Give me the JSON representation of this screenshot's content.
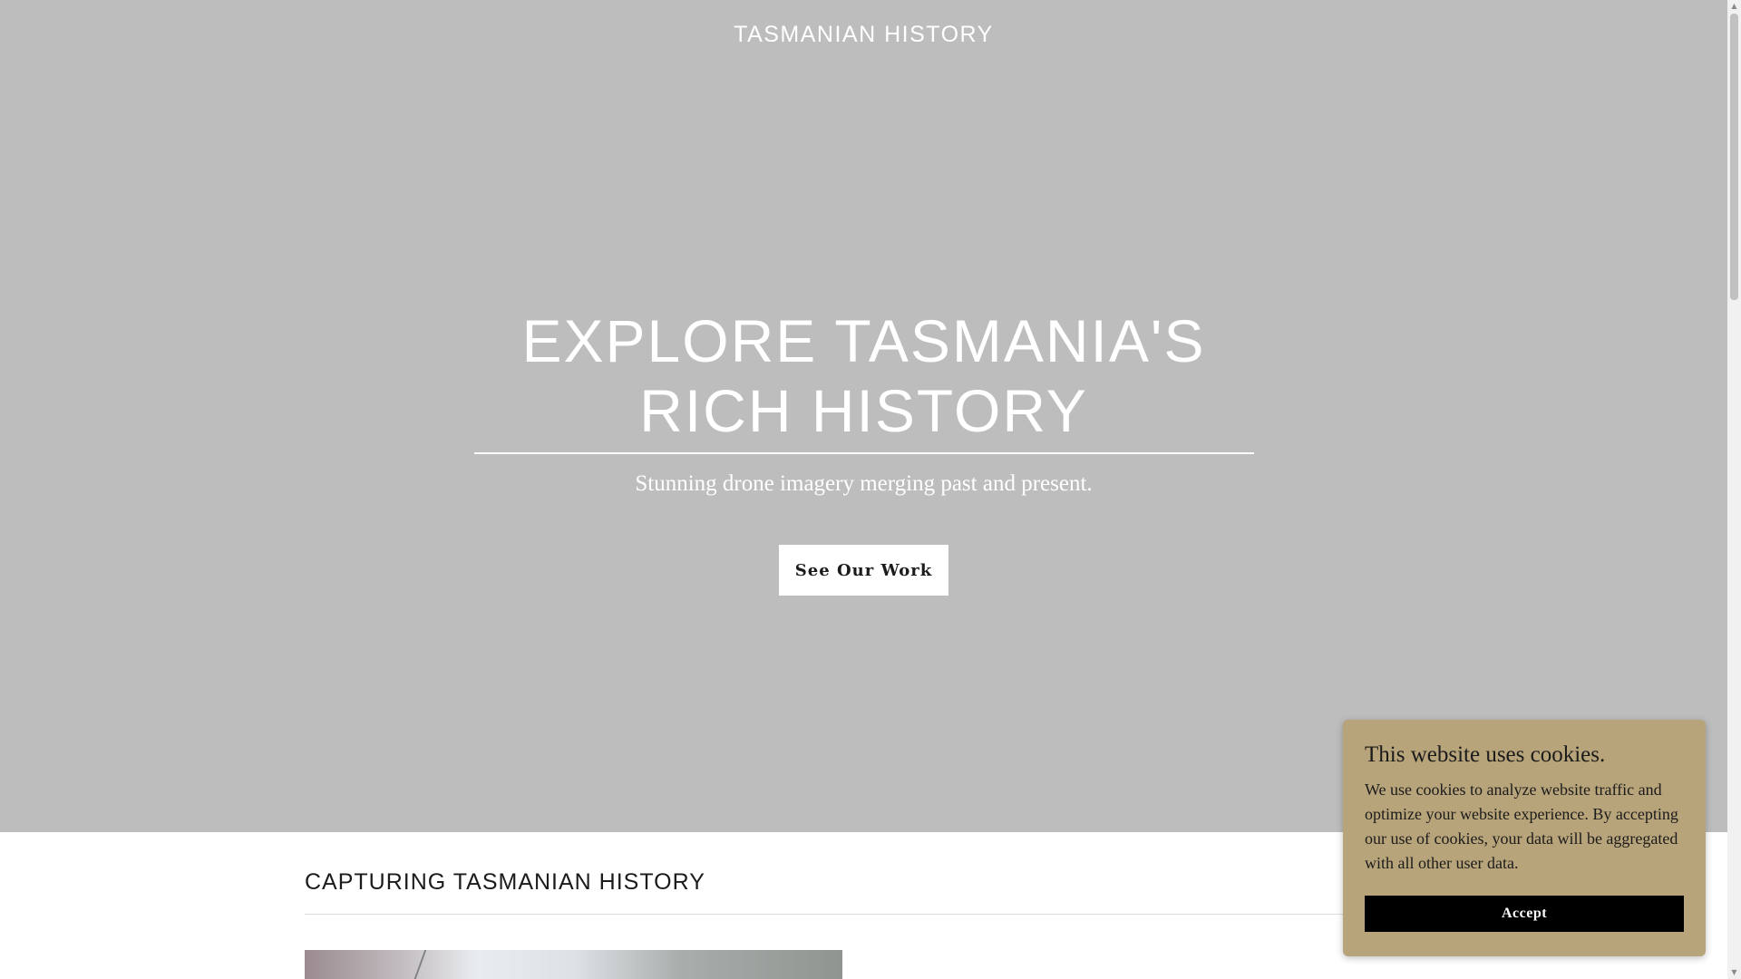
{
  "header": {
    "site_title": "TASMANIAN HISTORY"
  },
  "hero": {
    "heading_line1": "EXPLORE TASMANIA'S",
    "heading_line2": "RICH HISTORY",
    "subtitle": "Stunning drone imagery merging past and present.",
    "cta_label": "See Our Work",
    "background_color": "#bdbdbd"
  },
  "section": {
    "heading": "CAPTURING TASMANIAN HISTORY"
  },
  "cookie_banner": {
    "title": "This website uses cookies.",
    "text": "We use cookies to analyze website traffic and optimize your website experience. By accepting our use of cookies, your data will be aggregated with all other user data.",
    "accept_label": "Accept",
    "background_color": "#b8a47a"
  },
  "scrollbar": {
    "up_icon": "▲",
    "down_icon": "▼"
  }
}
